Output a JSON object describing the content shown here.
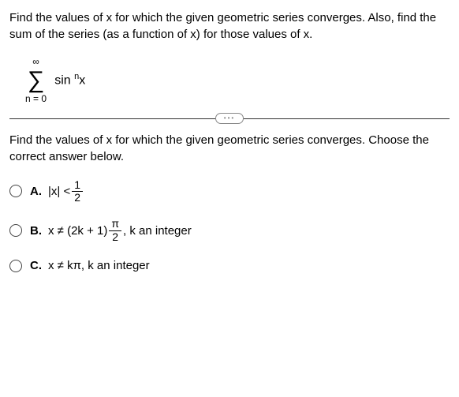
{
  "question": "Find the values of x for which the given geometric series converges. Also, find the sum of the series (as a function of x) for those values of x.",
  "formula": {
    "upper": "∞",
    "lower": "n = 0",
    "term_base": "sin",
    "term_exp": "n",
    "term_var": "x"
  },
  "sub_question": "Find the values of x for which the given geometric series converges. Choose the correct answer below.",
  "options": {
    "a": {
      "label": "A.",
      "lhs": "|x| <",
      "frac_num": "1",
      "frac_den": "2"
    },
    "b": {
      "label": "B.",
      "pre": "x ≠ (2k + 1)",
      "frac_num": "π",
      "frac_den": "2",
      "post": ", k an integer"
    },
    "c": {
      "label": "C.",
      "text": "x ≠ kπ, k an integer"
    }
  },
  "chart_data": {
    "type": "table",
    "title": "Multiple choice options",
    "categories": [
      "A",
      "B",
      "C"
    ],
    "values": [
      "|x| < 1/2",
      "x ≠ (2k+1)π/2, k an integer",
      "x ≠ kπ, k an integer"
    ]
  }
}
